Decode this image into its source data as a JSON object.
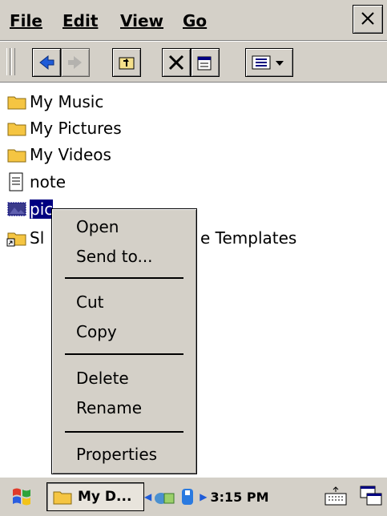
{
  "menubar": {
    "file_label": "File",
    "edit_label": "Edit",
    "view_label": "View",
    "go_label": "Go"
  },
  "files": [
    {
      "name": "My Music",
      "icon": "folder-icon"
    },
    {
      "name": "My Pictures",
      "icon": "folder-icon"
    },
    {
      "name": "My Videos",
      "icon": "folder-icon"
    },
    {
      "name": "note",
      "icon": "text-file-icon"
    },
    {
      "name": "pic",
      "icon": "image-file-icon",
      "selected": true
    },
    {
      "name": "Sl",
      "tail": "e Templates",
      "icon": "shortcut-folder-icon"
    }
  ],
  "context_menu": {
    "open": "Open",
    "send_to": "Send to...",
    "cut": "Cut",
    "copy": "Copy",
    "delete": "Delete",
    "rename": "Rename",
    "properties": "Properties"
  },
  "taskbar": {
    "task_label": "My D...",
    "time": "3:15 PM"
  },
  "colors": {
    "chrome": "#d4d0c8",
    "selection": "#000080",
    "folder": "#f5c542"
  }
}
